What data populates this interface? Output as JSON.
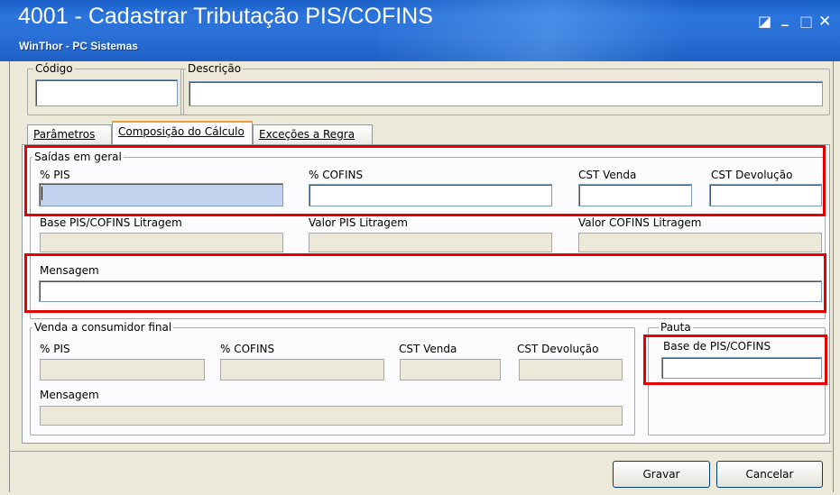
{
  "window": {
    "title": "4001 - Cadastrar Tributação PIS/COFINS",
    "subtitle": "WinThor - PC Sistemas",
    "controls": {
      "restore": "◪",
      "minimize": "_",
      "maximize": "□",
      "close": "✕"
    }
  },
  "header": {
    "codigo_label": "Código",
    "codigo_value": "",
    "descricao_label": "Descrição",
    "descricao_value": ""
  },
  "tabs": [
    {
      "label": "Parâmetros",
      "active": false
    },
    {
      "label": "Composição do Cálculo",
      "active": true
    },
    {
      "label": "Exceções a Regra",
      "active": false
    }
  ],
  "saidas": {
    "group_label": "Saídas em geral",
    "pis_label": "% PIS",
    "cofins_label": "% COFINS",
    "cst_venda_label": "CST Venda",
    "cst_devolucao_label": "CST Devolução",
    "base_litragem_label": "Base PIS/COFINS Litragem",
    "valor_pis_litragem_label": "Valor PIS Litragem",
    "valor_cofins_litragem_label": "Valor COFINS Litragem",
    "mensagem_label": "Mensagem"
  },
  "consumidor": {
    "group_label": "Venda a consumidor final",
    "pis_label": "% PIS",
    "cofins_label": "% COFINS",
    "cst_venda_label": "CST Venda",
    "cst_devolucao_label": "CST Devolução",
    "mensagem_label": "Mensagem"
  },
  "pauta": {
    "group_label": "Pauta",
    "base_label": "Base de PIS/COFINS"
  },
  "buttons": {
    "gravar": "Gravar",
    "cancelar": "Cancelar"
  },
  "colors": {
    "titlebar": "#2b74dc",
    "highlight": "#e30000",
    "focus_field": "#c2d3ef"
  }
}
